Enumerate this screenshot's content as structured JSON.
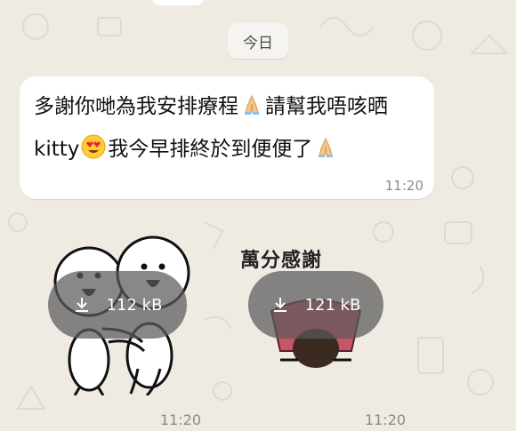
{
  "date_separator": {
    "label": "今日"
  },
  "message": {
    "text_part1": "多謝你哋為我安排療程",
    "text_part2": "請幫我唔咳晒kitty",
    "text_part3": "我今早排終於到便便了",
    "emojis": [
      "folded-hands",
      "heart-eyes-face",
      "folded-hands"
    ],
    "time": "11:20"
  },
  "stickers": [
    {
      "size_label": "112 kB",
      "time": "11:20",
      "icon": "download-icon"
    },
    {
      "caption": "萬分感謝",
      "size_label": "121 kB",
      "time": "11:20",
      "icon": "download-icon"
    }
  ],
  "colors": {
    "chat_background": "#efeae2",
    "bubble": "#ffffff",
    "download_pill": "#5a5a5a",
    "timestamp": "#8a8a8a"
  }
}
